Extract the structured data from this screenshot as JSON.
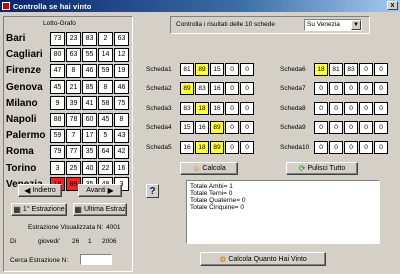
{
  "window": {
    "title": "Controlla se hai vinto",
    "close_label": "x"
  },
  "lotto_grid": {
    "label": "Lotto-Grafo",
    "rows": [
      {
        "name": "Bari",
        "numbers": [
          "73",
          "23",
          "83",
          "2",
          "63"
        ],
        "hits": [
          "",
          "",
          "",
          "",
          ""
        ]
      },
      {
        "name": "Cagliari",
        "numbers": [
          "80",
          "63",
          "55",
          "14",
          "12"
        ],
        "hits": [
          "",
          "",
          "",
          "",
          ""
        ]
      },
      {
        "name": "Firenze",
        "numbers": [
          "47",
          "8",
          "46",
          "59",
          "19"
        ],
        "hits": [
          "",
          "",
          "",
          "",
          ""
        ]
      },
      {
        "name": "Genova",
        "numbers": [
          "45",
          "21",
          "85",
          "8",
          "46"
        ],
        "hits": [
          "",
          "",
          "",
          "",
          ""
        ]
      },
      {
        "name": "Milano",
        "numbers": [
          "9",
          "39",
          "41",
          "58",
          "75"
        ],
        "hits": [
          "",
          "",
          "",
          "",
          ""
        ]
      },
      {
        "name": "Napoli",
        "numbers": [
          "88",
          "78",
          "60",
          "45",
          "8"
        ],
        "hits": [
          "",
          "",
          "",
          "",
          ""
        ]
      },
      {
        "name": "Palermo",
        "numbers": [
          "59",
          "7",
          "17",
          "5",
          "43"
        ],
        "hits": [
          "",
          "",
          "",
          "",
          ""
        ]
      },
      {
        "name": "Roma",
        "numbers": [
          "79",
          "77",
          "35",
          "64",
          "42"
        ],
        "hits": [
          "",
          "",
          "",
          "",
          ""
        ]
      },
      {
        "name": "Torino",
        "numbers": [
          "3",
          "25",
          "40",
          "22",
          "16"
        ],
        "hits": [
          "",
          "",
          "",
          "",
          ""
        ]
      },
      {
        "name": "Venezia",
        "numbers": [
          "18",
          "89",
          "35",
          "48",
          "3"
        ],
        "hits": [
          "red",
          "red",
          "",
          "",
          ""
        ]
      }
    ]
  },
  "nav": {
    "indietro": "Indietro",
    "avanti": "Avanti",
    "prima": "1° Estrazione",
    "ultima": "Ultima Estraz"
  },
  "estrazione": {
    "visualizzata_label": "Estrazione Visualizzata N:",
    "visualizzata_value": "4001",
    "di_label": "Di",
    "giorno": "giovedi'",
    "day": "26",
    "month": "1",
    "year": "2006",
    "cerca_label": "Cerca Estrazione N:",
    "cerca_value": ""
  },
  "controls": {
    "combo_label": "Controlla i risultati delle 10 schede",
    "combo_value": "Su Venezia",
    "combo_arrow": "▼"
  },
  "schede": [
    {
      "label": "Scheda1",
      "numbers": [
        "81",
        "89",
        "15",
        "0",
        "0"
      ],
      "hits": [
        "",
        "yellow",
        "",
        "",
        ""
      ]
    },
    {
      "label": "Scheda2",
      "numbers": [
        "89",
        "83",
        "16",
        "0",
        "0"
      ],
      "hits": [
        "yellow",
        "",
        "",
        "",
        ""
      ]
    },
    {
      "label": "Scheda3",
      "numbers": [
        "83",
        "18",
        "16",
        "0",
        "0"
      ],
      "hits": [
        "",
        "yellow",
        "",
        "",
        ""
      ]
    },
    {
      "label": "Scheda4",
      "numbers": [
        "15",
        "16",
        "89",
        "0",
        "0"
      ],
      "hits": [
        "",
        "",
        "yellow",
        "",
        ""
      ]
    },
    {
      "label": "Scheda5",
      "numbers": [
        "16",
        "18",
        "89",
        "0",
        "0"
      ],
      "hits": [
        "",
        "yellow",
        "yellow",
        "",
        ""
      ]
    },
    {
      "label": "Scheda6",
      "numbers": [
        "18",
        "81",
        "83",
        "0",
        "0"
      ],
      "hits": [
        "yellow",
        "",
        "",
        "",
        ""
      ]
    },
    {
      "label": "Scheda7",
      "numbers": [
        "0",
        "0",
        "0",
        "0",
        "0"
      ],
      "hits": [
        "",
        "",
        "",
        "",
        ""
      ]
    },
    {
      "label": "Scheda8",
      "numbers": [
        "0",
        "0",
        "0",
        "0",
        "0"
      ],
      "hits": [
        "",
        "",
        "",
        "",
        ""
      ]
    },
    {
      "label": "Scheda9",
      "numbers": [
        "0",
        "0",
        "0",
        "0",
        "0"
      ],
      "hits": [
        "",
        "",
        "",
        "",
        ""
      ]
    },
    {
      "label": "Scheda10",
      "numbers": [
        "0",
        "0",
        "0",
        "0",
        "0"
      ],
      "hits": [
        "",
        "",
        "",
        "",
        ""
      ]
    }
  ],
  "actions": {
    "calcola": "Calcola",
    "pulisci": "Pulisci Tutto",
    "help": "?",
    "calcola_quanto": "Calcola Quanto Hai Vinto"
  },
  "results": [
    "Totale Ambi= 1",
    "Totale Terni= 0",
    "Totale Quaterne= 0",
    "Totale Cinquine= 0"
  ],
  "colors": {
    "hit_yellow": "#ffff33",
    "hit_red": "#ff2020",
    "titlebar": "#0a246a"
  }
}
